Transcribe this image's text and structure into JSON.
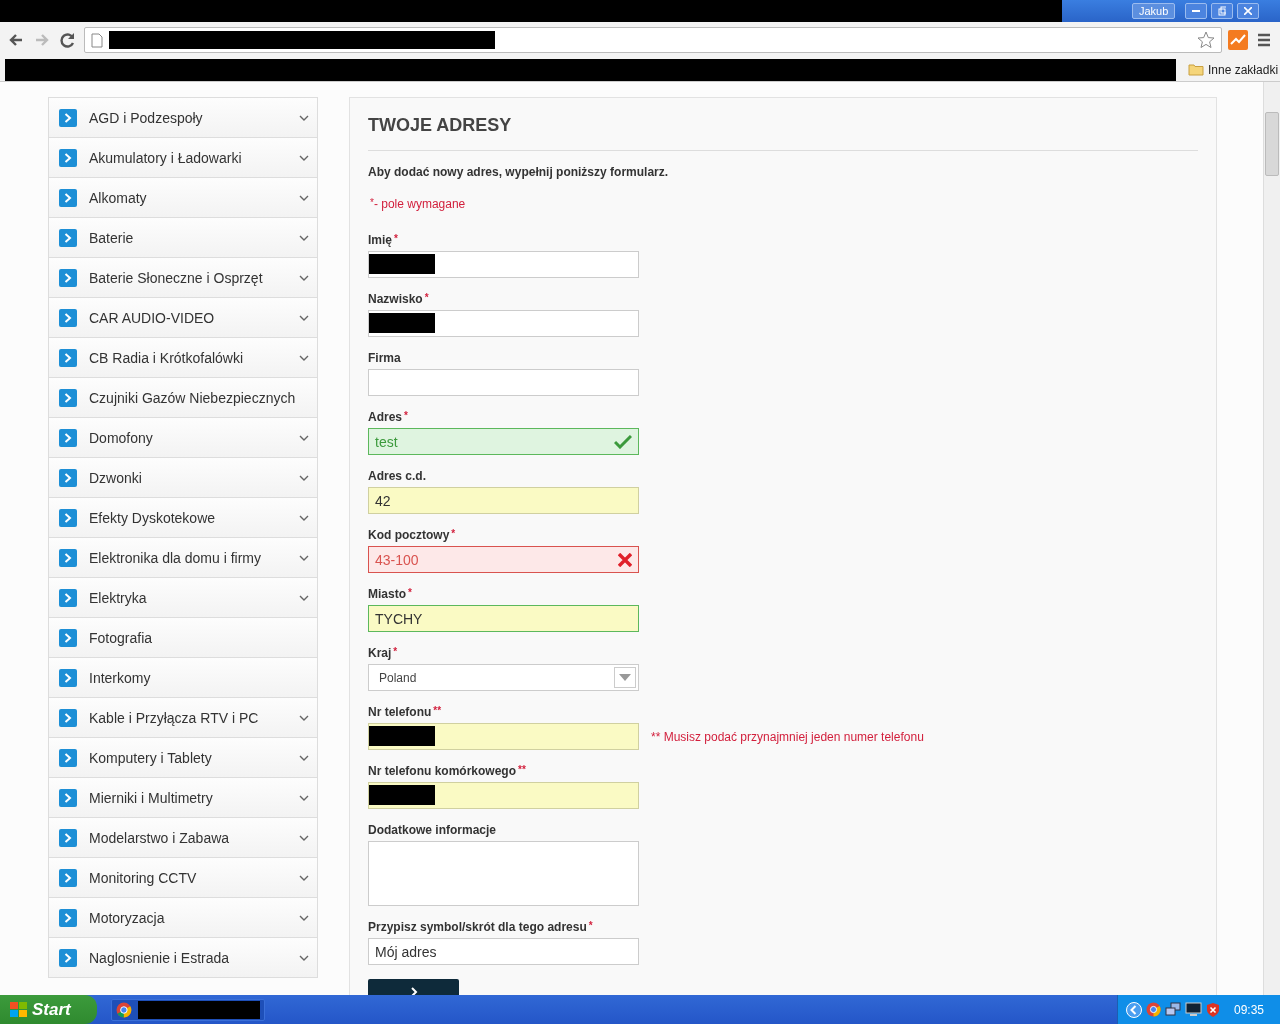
{
  "browser": {
    "profile": "Jakub",
    "bookmarks_folder": "Inne zakładki"
  },
  "sidebar": {
    "items": [
      {
        "label": "AGD i Podzespoły",
        "expandable": true
      },
      {
        "label": "Akumulatory i Ładowarki",
        "expandable": true
      },
      {
        "label": "Alkomaty",
        "expandable": true
      },
      {
        "label": "Baterie",
        "expandable": true
      },
      {
        "label": "Baterie Słoneczne i Osprzęt",
        "expandable": true
      },
      {
        "label": "CAR AUDIO-VIDEO",
        "expandable": true
      },
      {
        "label": "CB Radia i Krótkofalówki",
        "expandable": true
      },
      {
        "label": "Czujniki Gazów Niebezpiecznych",
        "expandable": false
      },
      {
        "label": "Domofony",
        "expandable": true
      },
      {
        "label": "Dzwonki",
        "expandable": true
      },
      {
        "label": "Efekty Dyskotekowe",
        "expandable": true
      },
      {
        "label": "Elektronika dla domu i firmy",
        "expandable": true
      },
      {
        "label": "Elektryka",
        "expandable": true
      },
      {
        "label": "Fotografia",
        "expandable": false
      },
      {
        "label": "Interkomy",
        "expandable": false
      },
      {
        "label": "Kable i Przyłącza RTV i PC",
        "expandable": true
      },
      {
        "label": "Komputery i Tablety",
        "expandable": true
      },
      {
        "label": "Mierniki i Multimetry",
        "expandable": true
      },
      {
        "label": "Modelarstwo i Zabawa",
        "expandable": true
      },
      {
        "label": "Monitoring CCTV",
        "expandable": true
      },
      {
        "label": "Motoryzacja",
        "expandable": true
      },
      {
        "label": "Naglosnienie i Estrada",
        "expandable": true
      }
    ]
  },
  "form": {
    "title": "TWOJE ADRESY",
    "intro": "Aby dodać nowy adres, wypełnij poniższy formularz.",
    "required_note": {
      "mark": "*",
      "text": "- pole wymagane"
    },
    "fields": [
      {
        "kind": "text",
        "label": "Imię",
        "required": "*",
        "redacted": true,
        "valid": false,
        "error": false,
        "autofill": false
      },
      {
        "kind": "text",
        "label": "Nazwisko",
        "required": "*",
        "redacted": true,
        "valid": false,
        "error": false,
        "autofill": false
      },
      {
        "kind": "text",
        "label": "Firma",
        "valid": false,
        "error": false,
        "autofill": false
      },
      {
        "kind": "text",
        "label": "Adres",
        "required": "*",
        "value": "test",
        "valid": true,
        "error": false,
        "autofill": false
      },
      {
        "kind": "text",
        "label": "Adres c.d.",
        "value": "42",
        "valid": false,
        "error": false,
        "autofill": true
      },
      {
        "kind": "text",
        "label": "Kod pocztowy",
        "required": "*",
        "value": "43-100",
        "valid": false,
        "error": true,
        "autofill": false
      },
      {
        "kind": "text",
        "label": "Miasto",
        "required": "*",
        "value": "TYCHY",
        "valid": true,
        "error": false,
        "autofill": true
      },
      {
        "kind": "select",
        "label": "Kraj",
        "required": "*",
        "value": "Poland"
      },
      {
        "kind": "text",
        "label": "Nr telefonu",
        "required": "**",
        "redacted": true,
        "valid": false,
        "error": false,
        "autofill": true,
        "hint": "** Musisz podać przynajmniej jeden numer telefonu"
      },
      {
        "kind": "text",
        "label": "Nr telefonu komórkowego",
        "required": "**",
        "redacted": true,
        "valid": false,
        "error": false,
        "autofill": true
      },
      {
        "kind": "textarea",
        "label": "Dodatkowe informacje"
      },
      {
        "kind": "text",
        "label": "Przypisz symbol/skrót dla tego adresu",
        "required": "*",
        "value": "Mój adres",
        "valid": false,
        "error": false,
        "autofill": false
      }
    ]
  },
  "taskbar": {
    "start": "Start",
    "clock": "09:35"
  }
}
